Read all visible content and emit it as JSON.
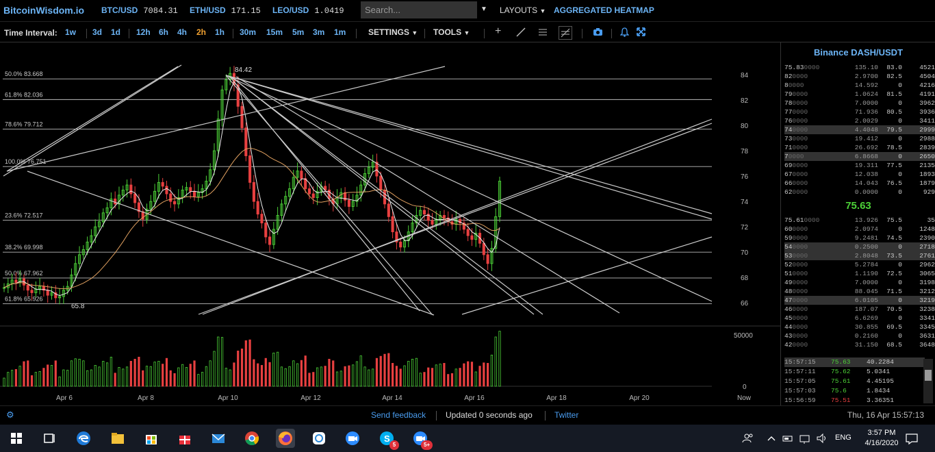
{
  "header": {
    "brand": "BitcoinWisdom.io",
    "tickers": [
      {
        "symbol": "BTC/USD",
        "price": "7084.31"
      },
      {
        "symbol": "ETH/USD",
        "price": "171.15"
      },
      {
        "symbol": "LEO/USD",
        "price": "1.0419"
      }
    ],
    "search_placeholder": "Search...",
    "layouts_label": "LAYOUTS",
    "heatmap_label": "AGGREGATED HEATMAP"
  },
  "toolbar": {
    "time_interval_label": "Time Interval:",
    "intervals": [
      "1w",
      "3d",
      "1d",
      "12h",
      "6h",
      "4h",
      "2h",
      "1h",
      "30m",
      "15m",
      "5m",
      "3m",
      "1m"
    ],
    "selected_interval": "2h",
    "settings_label": "SETTINGS",
    "tools_label": "TOOLS"
  },
  "chart_data": {
    "type": "candlestick",
    "y_ticks": [
      "84",
      "82",
      "80",
      "78",
      "76",
      "74",
      "72",
      "70",
      "68",
      "66"
    ],
    "ylim": [
      64.5,
      86
    ],
    "x_ticks": [
      "Apr 6",
      "Apr 8",
      "Apr 10",
      "Apr 12",
      "Apr 14",
      "Apr 16",
      "Apr 18",
      "Apr 20",
      "Now"
    ],
    "fib_levels": [
      {
        "label": "50.0% 83.668",
        "value": 83.668
      },
      {
        "label": "61.8% 82.036",
        "value": 82.036
      },
      {
        "label": "78.6% 79.712",
        "value": 79.712
      },
      {
        "label": "100.0% 76.751",
        "value": 76.751
      },
      {
        "label": "23.6% 72.517",
        "value": 72.517
      },
      {
        "label": "38.2% 69.998",
        "value": 69.998
      },
      {
        "label": "50.0% 67.962",
        "value": 67.962
      },
      {
        "label": "61.8% 65.926",
        "value": 65.926
      }
    ],
    "high_label": "84.42",
    "low_label": "65.8",
    "volume_ticks": [
      "50000",
      "0"
    ],
    "closes": [
      67.2,
      67.5,
      67.8,
      67.6,
      67.9,
      67.4,
      67.0,
      66.8,
      67.1,
      67.3,
      67.0,
      66.6,
      66.8,
      66.4,
      66.5,
      67.0,
      67.3,
      68.2,
      69.1,
      69.8,
      70.2,
      70.8,
      71.3,
      72.0,
      72.4,
      73.1,
      73.5,
      74.2,
      73.8,
      74.5,
      74.9,
      75.3,
      74.6,
      73.9,
      73.2,
      72.6,
      73.4,
      74.0,
      74.8,
      75.5,
      75.2,
      74.6,
      74.0,
      73.8,
      74.3,
      74.9,
      75.1,
      74.8,
      74.4,
      74.7,
      75.0,
      75.6,
      76.5,
      78.0,
      80.5,
      82.8,
      83.6,
      84.1,
      83.2,
      81.5,
      79.8,
      77.6,
      75.5,
      74.0,
      73.0,
      72.3,
      71.2,
      70.6,
      71.8,
      72.9,
      73.8,
      74.4,
      75.0,
      75.9,
      76.4,
      75.8,
      75.0,
      74.6,
      74.3,
      74.8,
      75.2,
      74.9,
      74.2,
      73.8,
      74.3,
      74.7,
      74.1,
      73.6,
      74.0,
      74.5,
      75.3,
      76.2,
      76.7,
      77.1,
      76.0,
      74.9,
      73.8,
      72.8,
      71.6,
      70.8,
      70.4,
      70.9,
      71.6,
      72.3,
      72.9,
      73.3,
      73.0,
      72.5,
      72.2,
      72.6,
      72.9,
      72.7,
      72.4,
      72.2,
      72.6,
      72.3,
      71.8,
      71.3,
      71.0,
      71.5,
      70.7,
      69.8,
      69.1,
      70.3,
      72.8,
      75.6
    ],
    "legend": []
  },
  "sidebar": {
    "title": "Binance DASH/USDT",
    "asks": [
      {
        "price": "75.83",
        "price_dim": "0000",
        "amount": "135.10",
        "sum": "83.0",
        "total": "4521"
      },
      {
        "price": "82",
        "price_dim": "0000",
        "amount": "2.9700",
        "sum": "82.5",
        "total": "4504"
      },
      {
        "price": "8",
        "price_dim": "0000",
        "amount": "14.592",
        "sum": "0",
        "total": "4216"
      },
      {
        "price": "79",
        "price_dim": "0000",
        "amount": "1.0624",
        "sum": "81.5",
        "total": "4191"
      },
      {
        "price": "78",
        "price_dim": "0000",
        "amount": "7.0000",
        "sum": "0",
        "total": "3962"
      },
      {
        "price": "77",
        "price_dim": "0000",
        "amount": "71.936",
        "sum": "80.5",
        "total": "3936"
      },
      {
        "price": "76",
        "price_dim": "0000",
        "amount": "2.0029",
        "sum": "0",
        "total": "3411"
      },
      {
        "price": "74",
        "price_dim": "0000",
        "amount": "4.4048",
        "sum": "79.5",
        "total": "2999",
        "hl": true
      },
      {
        "price": "73",
        "price_dim": "0000",
        "amount": "19.412",
        "sum": "0",
        "total": "2988"
      },
      {
        "price": "71",
        "price_dim": "0000",
        "amount": "26.692",
        "sum": "78.5",
        "total": "2839"
      },
      {
        "price": "7",
        "price_dim": "0000",
        "amount": "6.8668",
        "sum": "0",
        "total": "2650",
        "hl": true
      },
      {
        "price": "69",
        "price_dim": "0000",
        "amount": "19.311",
        "sum": "77.5",
        "total": "2135"
      },
      {
        "price": "67",
        "price_dim": "0000",
        "amount": "12.038",
        "sum": "0",
        "total": "1893"
      },
      {
        "price": "66",
        "price_dim": "0000",
        "amount": "14.043",
        "sum": "76.5",
        "total": "1879"
      },
      {
        "price": "62",
        "price_dim": "0000",
        "amount": "0.0000",
        "sum": "0",
        "total": "929"
      }
    ],
    "mid_price": "75.63",
    "bids": [
      {
        "price": "75.61",
        "price_dim": "0000",
        "amount": "13.926",
        "sum": "75.5",
        "total": "35"
      },
      {
        "price": "60",
        "price_dim": "0000",
        "amount": "2.0974",
        "sum": "0",
        "total": "1248"
      },
      {
        "price": "59",
        "price_dim": "0000",
        "amount": "9.2481",
        "sum": "74.5",
        "total": "2390"
      },
      {
        "price": "54",
        "price_dim": "0000",
        "amount": "0.2500",
        "sum": "0",
        "total": "2718",
        "hl": true
      },
      {
        "price": "53",
        "price_dim": "0000",
        "amount": "2.8048",
        "sum": "73.5",
        "total": "2761",
        "hl": true
      },
      {
        "price": "52",
        "price_dim": "0000",
        "amount": "5.2784",
        "sum": "0",
        "total": "2962"
      },
      {
        "price": "51",
        "price_dim": "0000",
        "amount": "1.1190",
        "sum": "72.5",
        "total": "3065"
      },
      {
        "price": "49",
        "price_dim": "0000",
        "amount": "7.0000",
        "sum": "0",
        "total": "3198"
      },
      {
        "price": "48",
        "price_dim": "0000",
        "amount": "88.045",
        "sum": "71.5",
        "total": "3212"
      },
      {
        "price": "47",
        "price_dim": "0000",
        "amount": "6.0105",
        "sum": "0",
        "total": "3219",
        "hl": true
      },
      {
        "price": "46",
        "price_dim": "0000",
        "amount": "187.07",
        "sum": "70.5",
        "total": "3238"
      },
      {
        "price": "45",
        "price_dim": "0000",
        "amount": "6.6269",
        "sum": "0",
        "total": "3341"
      },
      {
        "price": "44",
        "price_dim": "0000",
        "amount": "30.855",
        "sum": "69.5",
        "total": "3345"
      },
      {
        "price": "43",
        "price_dim": "0000",
        "amount": "0.2160",
        "sum": "0",
        "total": "3631"
      },
      {
        "price": "42",
        "price_dim": "0000",
        "amount": "31.150",
        "sum": "68.5",
        "total": "3648"
      }
    ],
    "trades": [
      {
        "time": "15:57:15",
        "price": "75.63",
        "dir": "up",
        "vol": "40.2284",
        "hl": true
      },
      {
        "time": "15:57:11",
        "price": "75.62",
        "dir": "up",
        "vol": "5.0341"
      },
      {
        "time": "15:57:05",
        "price": "75.61",
        "dir": "up",
        "vol": "4.45195"
      },
      {
        "time": "15:57:03",
        "price": "75.6",
        "dir": "up",
        "vol": "1.8434"
      },
      {
        "time": "15:56:59",
        "price": "75.51",
        "dir": "dn",
        "vol": "3.36351"
      }
    ]
  },
  "footer": {
    "send_feedback": "Send feedback",
    "updated": "Updated 0 seconds ago",
    "twitter": "Twitter",
    "datetime": "Thu, 16 Apr 15:57:13"
  },
  "taskbar": {
    "time": "3:57 PM",
    "date": "4/16/2020",
    "lang": "ENG",
    "skype_badge": "5",
    "zoom_badge": "5+"
  },
  "colors": {
    "brand": "#6cb4f5",
    "up": "#4cd137",
    "down": "#e84040",
    "selected_interval": "#f0a030"
  }
}
